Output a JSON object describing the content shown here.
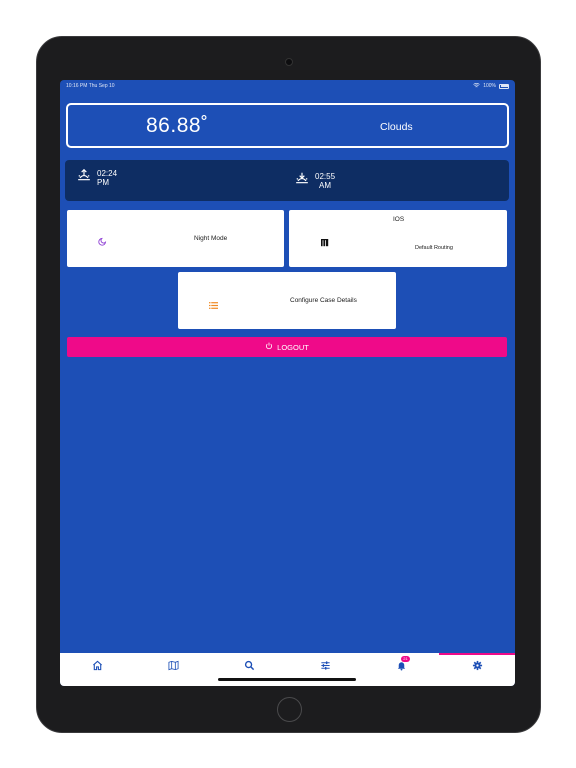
{
  "status_bar": {
    "time_date": "10:16 PM   Thu Sep 10",
    "battery": "100%"
  },
  "weather": {
    "temperature": "86.88˚",
    "condition": "Clouds"
  },
  "sun": {
    "sunrise_time": "02:24",
    "sunrise_period": "PM",
    "sunset_time": "02:55",
    "sunset_period": "AM"
  },
  "tiles": {
    "night_mode": "Night Mode",
    "ios_title": "IOS",
    "ios_subtitle": "Default Routing",
    "configure_case": "Configure Case Details"
  },
  "logout_label": "LOGOUT",
  "tabbar": {
    "items": [
      {
        "icon": "home-icon"
      },
      {
        "icon": "map-icon"
      },
      {
        "icon": "search-icon"
      },
      {
        "icon": "sliders-icon"
      },
      {
        "icon": "notification-icon",
        "badge": "21"
      },
      {
        "icon": "gear-icon",
        "active": true
      }
    ]
  },
  "colors": {
    "background": "#1d4fb6",
    "sun_card": "#0e2d63",
    "accent": "#ef0a89",
    "active_tab": "#1d4fb6"
  }
}
